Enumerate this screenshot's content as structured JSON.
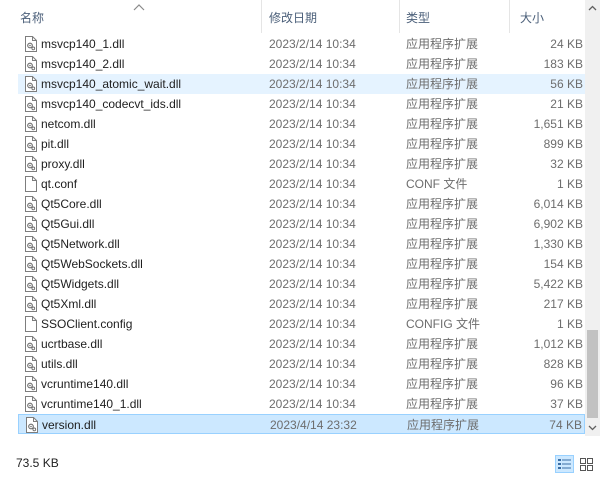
{
  "columns": {
    "name": "名称",
    "date": "修改日期",
    "type": "类型",
    "size": "大小"
  },
  "files": [
    {
      "name": "msvcp140_1.dll",
      "date": "2023/2/14 10:34",
      "type": "应用程序扩展",
      "size": "24 KB",
      "icon": "dll-file-icon"
    },
    {
      "name": "msvcp140_2.dll",
      "date": "2023/2/14 10:34",
      "type": "应用程序扩展",
      "size": "183 KB",
      "icon": "dll-file-icon"
    },
    {
      "name": "msvcp140_atomic_wait.dll",
      "date": "2023/2/14 10:34",
      "type": "应用程序扩展",
      "size": "56 KB",
      "icon": "dll-file-icon"
    },
    {
      "name": "msvcp140_codecvt_ids.dll",
      "date": "2023/2/14 10:34",
      "type": "应用程序扩展",
      "size": "21 KB",
      "icon": "dll-file-icon"
    },
    {
      "name": "netcom.dll",
      "date": "2023/2/14 10:34",
      "type": "应用程序扩展",
      "size": "1,651 KB",
      "icon": "dll-file-icon"
    },
    {
      "name": "pit.dll",
      "date": "2023/2/14 10:34",
      "type": "应用程序扩展",
      "size": "899 KB",
      "icon": "dll-file-icon"
    },
    {
      "name": "proxy.dll",
      "date": "2023/2/14 10:34",
      "type": "应用程序扩展",
      "size": "32 KB",
      "icon": "dll-file-icon"
    },
    {
      "name": "qt.conf",
      "date": "2023/2/14 10:34",
      "type": "CONF 文件",
      "size": "1 KB",
      "icon": "blank-file-icon"
    },
    {
      "name": "Qt5Core.dll",
      "date": "2023/2/14 10:34",
      "type": "应用程序扩展",
      "size": "6,014 KB",
      "icon": "dll-file-icon"
    },
    {
      "name": "Qt5Gui.dll",
      "date": "2023/2/14 10:34",
      "type": "应用程序扩展",
      "size": "6,902 KB",
      "icon": "dll-file-icon"
    },
    {
      "name": "Qt5Network.dll",
      "date": "2023/2/14 10:34",
      "type": "应用程序扩展",
      "size": "1,330 KB",
      "icon": "dll-file-icon"
    },
    {
      "name": "Qt5WebSockets.dll",
      "date": "2023/2/14 10:34",
      "type": "应用程序扩展",
      "size": "154 KB",
      "icon": "dll-file-icon"
    },
    {
      "name": "Qt5Widgets.dll",
      "date": "2023/2/14 10:34",
      "type": "应用程序扩展",
      "size": "5,422 KB",
      "icon": "dll-file-icon"
    },
    {
      "name": "Qt5Xml.dll",
      "date": "2023/2/14 10:34",
      "type": "应用程序扩展",
      "size": "217 KB",
      "icon": "dll-file-icon"
    },
    {
      "name": "SSOClient.config",
      "date": "2023/2/14 10:34",
      "type": "CONFIG 文件",
      "size": "1 KB",
      "icon": "blank-file-icon"
    },
    {
      "name": "ucrtbase.dll",
      "date": "2023/2/14 10:34",
      "type": "应用程序扩展",
      "size": "1,012 KB",
      "icon": "dll-file-icon"
    },
    {
      "name": "utils.dll",
      "date": "2023/2/14 10:34",
      "type": "应用程序扩展",
      "size": "828 KB",
      "icon": "dll-file-icon"
    },
    {
      "name": "vcruntime140.dll",
      "date": "2023/2/14 10:34",
      "type": "应用程序扩展",
      "size": "96 KB",
      "icon": "dll-file-icon"
    },
    {
      "name": "vcruntime140_1.dll",
      "date": "2023/2/14 10:34",
      "type": "应用程序扩展",
      "size": "37 KB",
      "icon": "dll-file-icon"
    },
    {
      "name": "version.dll",
      "date": "2023/4/14 23:32",
      "type": "应用程序扩展",
      "size": "74 KB",
      "icon": "dll-file-icon"
    }
  ],
  "hover_row": "msvcp140_atomic_wait.dll",
  "selected_row": "version.dll",
  "status": {
    "selection_size": "73.5 KB"
  },
  "view_buttons": [
    {
      "name": "details-view-icon",
      "active": true
    },
    {
      "name": "large-icons-view-icon",
      "active": false
    }
  ],
  "colors": {
    "hover": "#e5f3ff",
    "selected": "#cce8ff",
    "selected_border": "#99d1ff",
    "header_text": "#4c607a",
    "secondary_text": "#6d6d6d"
  }
}
